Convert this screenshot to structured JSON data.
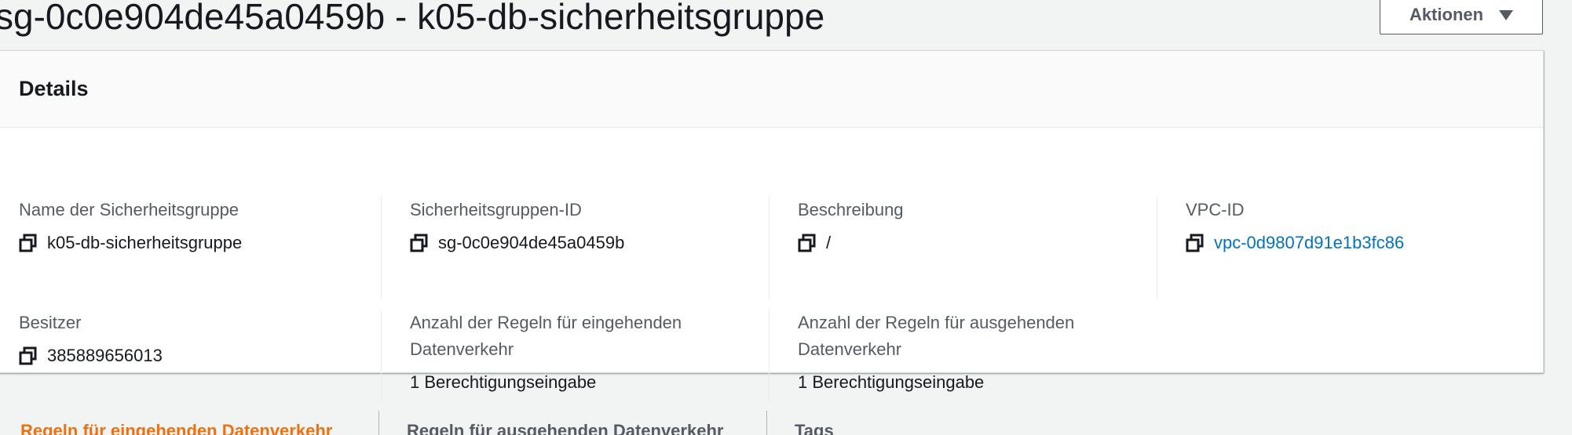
{
  "header": {
    "title": "sg-0c0e904de45a0459b - k05-db-sicherheitsgruppe",
    "actions_label": "Aktionen"
  },
  "details": {
    "title": "Details",
    "fields": {
      "name": {
        "label": "Name der Sicherheitsgruppe",
        "value": "k05-db-sicherheitsgruppe"
      },
      "sg_id": {
        "label": "Sicherheitsgruppen-ID",
        "value": "sg-0c0e904de45a0459b"
      },
      "description": {
        "label": "Beschreibung",
        "value": "/"
      },
      "vpc_id": {
        "label": "VPC-ID",
        "value": "vpc-0d9807d91e1b3fc86"
      },
      "owner": {
        "label": "Besitzer",
        "value": "385889656013"
      },
      "inbound_count": {
        "label_line1": "Anzahl der Regeln für eingehenden",
        "label_line2": "Datenverkehr",
        "value": "1 Berechtigungseingabe"
      },
      "outbound_count": {
        "label_line1": "Anzahl der Regeln für ausgehenden",
        "label_line2": "Datenverkehr",
        "value": "1 Berechtigungseingabe"
      }
    }
  },
  "tabs": [
    {
      "label": "Regeln für eingehenden Datenverkehr",
      "active": true
    },
    {
      "label": "Regeln für ausgehenden Datenverkehr",
      "active": false
    },
    {
      "label": "Tags",
      "active": false
    }
  ],
  "colors": {
    "link": "#0073bb",
    "active_tab": "#ec7211",
    "label": "#545b64",
    "text": "#16191f"
  },
  "icons": {
    "copy": "copy-icon",
    "caret": "caret-down-icon"
  }
}
